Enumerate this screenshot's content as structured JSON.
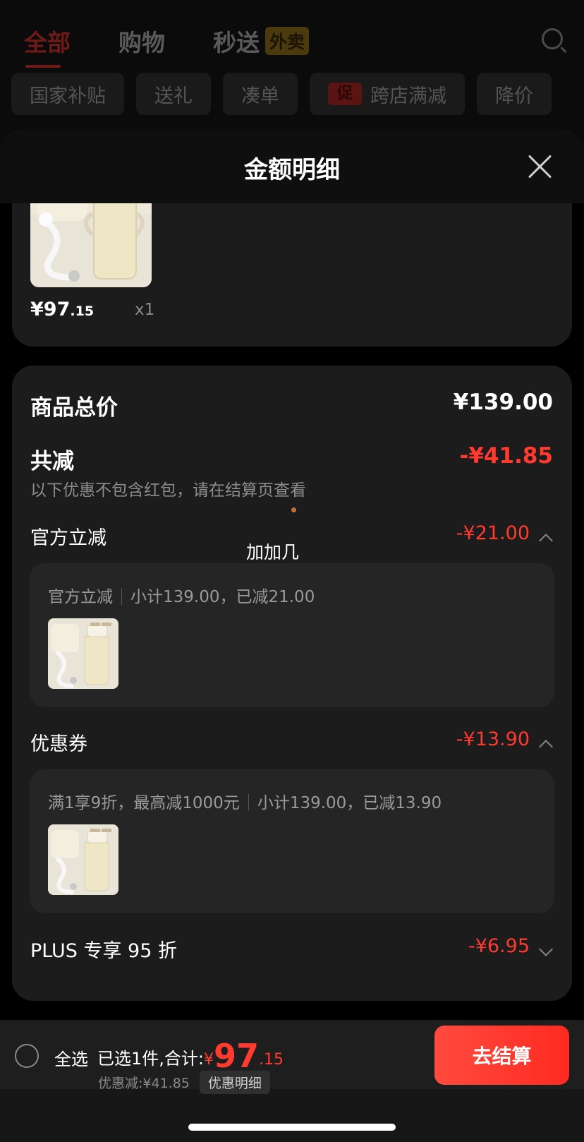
{
  "topnav": {
    "tabs": [
      {
        "label": "全部"
      },
      {
        "label": "购物"
      },
      {
        "label": "秒送",
        "badge": "外卖"
      }
    ]
  },
  "chips": [
    {
      "label": "国家补贴"
    },
    {
      "label": "送礼"
    },
    {
      "label": "凑单"
    },
    {
      "promo": "促",
      "label": "跨店满减"
    },
    {
      "label": "降价"
    }
  ],
  "sheet": {
    "title": "金额明细",
    "product": {
      "price_int": "¥97",
      "price_dec": ".15",
      "qty": "x1"
    },
    "total_label": "商品总价",
    "total_value": "¥139.00",
    "reduce_label": "共减",
    "reduce_value": "-¥41.85",
    "note": "以下优惠不包含红包，请在结算页查看",
    "floating_text": "加加几",
    "official": {
      "label": "官方立减",
      "value": "-¥21.00",
      "detail_a": "官方立减",
      "detail_b": "小计139.00，已减21.00"
    },
    "coupon": {
      "label": "优惠券",
      "value": "-¥13.90",
      "detail_a": "满1享9折，最高减1000元",
      "detail_b": "小计139.00，已减13.90"
    },
    "plus": {
      "label": "PLUS 专享 95 折",
      "value": "-¥6.95"
    }
  },
  "bottom": {
    "select_all": "全选",
    "summary_prefix": "已选1件,合计:",
    "yen": "¥",
    "total_int": "97",
    "total_dec": ".15",
    "discount": "优惠减:¥41.85",
    "detail_button": "优惠明细",
    "checkout": "去结算"
  },
  "colors": {
    "accent_red": "#ff3a2f",
    "sheet_card": "#1c1c1c"
  }
}
